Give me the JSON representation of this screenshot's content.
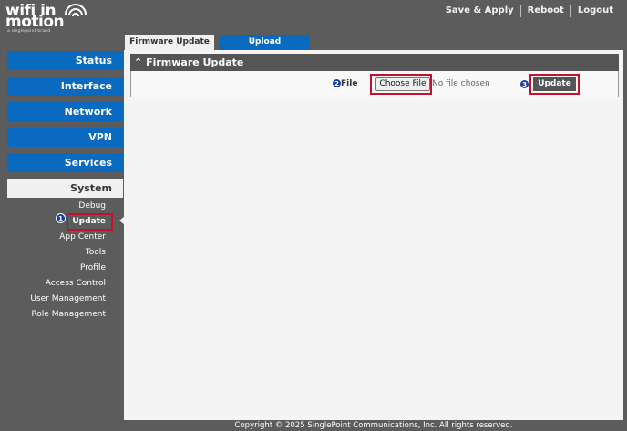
{
  "brand": {
    "line1": "wifi in",
    "line2": "motion",
    "tagline": "a singlepoint brand"
  },
  "topnav": {
    "save_apply": "Save & Apply",
    "reboot": "Reboot",
    "logout": "Logout"
  },
  "sidebar": {
    "status": "Status",
    "interface": "Interface",
    "network": "Network",
    "vpn": "VPN",
    "services": "Services",
    "system": "System"
  },
  "system_menu": {
    "debug": "Debug",
    "update": "Update",
    "app_center": "App Center",
    "tools": "Tools",
    "profile": "Profile",
    "access_control": "Access Control",
    "user_management": "User Management",
    "role_management": "Role Management"
  },
  "tabs": {
    "firmware_update": "Firmware Update",
    "upload": "Upload"
  },
  "panel": {
    "title": "Firmware Update",
    "file_label": "File",
    "choose_file": "Choose File",
    "no_file": "No file chosen",
    "update_button": "Update"
  },
  "markers": {
    "m1": "1",
    "m2": "2",
    "m3": "3"
  },
  "footer": "Copyright © 2025 SinglePoint Communications, Inc. All rights reserved.",
  "colors": {
    "background": "#5c5c5c",
    "accent": "#0a6abf",
    "highlight": "#c8102e",
    "marker": "#1e3aa8"
  }
}
